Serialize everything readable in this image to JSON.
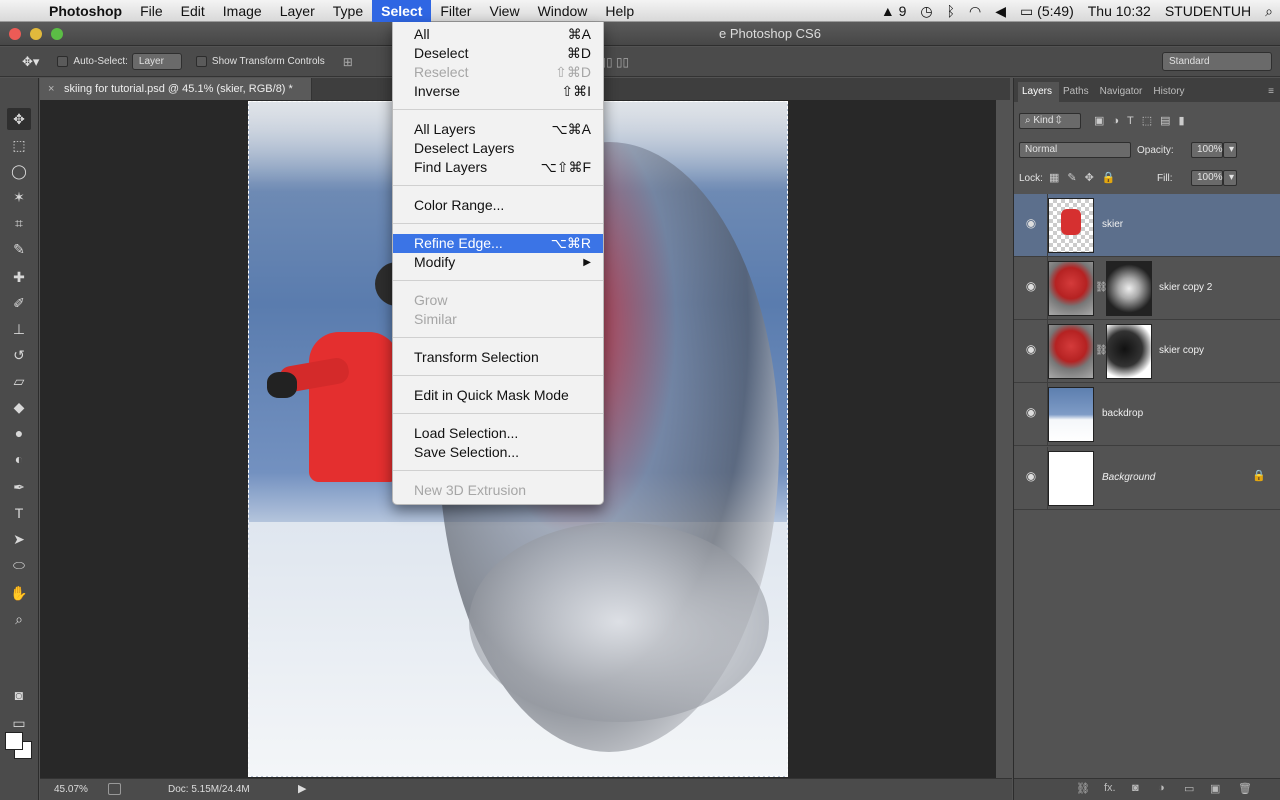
{
  "menubar": {
    "app": "Photoshop",
    "items": [
      "File",
      "Edit",
      "Image",
      "Layer",
      "Type",
      "Select",
      "Filter",
      "View",
      "Window",
      "Help"
    ],
    "active": "Select",
    "status": {
      "adobe_count": "9",
      "battery": "(5:49)",
      "clock": "Thu 10:32",
      "user": "STUDENTUH"
    }
  },
  "window": {
    "title": "e Photoshop CS6"
  },
  "options": {
    "auto_select_label": "Auto-Select:",
    "auto_select_value": "Layer",
    "show_transform_label": "Show Transform Controls",
    "workspace": "Standard"
  },
  "document": {
    "tab_title": "skiing for tutorial.psd @ 45.1% (skier, RGB/8) *"
  },
  "select_menu": {
    "items": [
      {
        "label": "All",
        "shortcut": "⌘A",
        "enabled": true
      },
      {
        "label": "Deselect",
        "shortcut": "⌘D",
        "enabled": true
      },
      {
        "label": "Reselect",
        "shortcut": "⇧⌘D",
        "enabled": false
      },
      {
        "label": "Inverse",
        "shortcut": "⇧⌘I",
        "enabled": true
      },
      {
        "label": "All Layers",
        "shortcut": "⌥⌘A",
        "enabled": true
      },
      {
        "label": "Deselect Layers",
        "shortcut": "",
        "enabled": true
      },
      {
        "label": "Find Layers",
        "shortcut": "⌥⇧⌘F",
        "enabled": true
      },
      {
        "label": "Color Range...",
        "shortcut": "",
        "enabled": true
      },
      {
        "label": "Refine Edge...",
        "shortcut": "⌥⌘R",
        "enabled": true,
        "highlighted": true
      },
      {
        "label": "Modify",
        "shortcut": "▶",
        "enabled": true
      },
      {
        "label": "Grow",
        "shortcut": "",
        "enabled": false
      },
      {
        "label": "Similar",
        "shortcut": "",
        "enabled": false
      },
      {
        "label": "Transform Selection",
        "shortcut": "",
        "enabled": true
      },
      {
        "label": "Edit in Quick Mask Mode",
        "shortcut": "",
        "enabled": true
      },
      {
        "label": "Load Selection...",
        "shortcut": "",
        "enabled": true
      },
      {
        "label": "Save Selection...",
        "shortcut": "",
        "enabled": true
      },
      {
        "label": "New 3D Extrusion",
        "shortcut": "",
        "enabled": false
      }
    ]
  },
  "status_bar": {
    "zoom": "45.07%",
    "doc_size": "Doc: 5.15M/24.4M"
  },
  "layers_panel": {
    "tabs": [
      "Layers",
      "Paths",
      "Navigator",
      "History"
    ],
    "kind_label": "Kind",
    "blend_mode": "Normal",
    "opacity_label": "Opacity:",
    "opacity": "100%",
    "lock_label": "Lock:",
    "fill_label": "Fill:",
    "fill": "100%",
    "layers": [
      {
        "name": "skier",
        "selected": true
      },
      {
        "name": "skier copy 2",
        "selected": false
      },
      {
        "name": "skier copy",
        "selected": false
      },
      {
        "name": "backdrop",
        "selected": false
      },
      {
        "name": "Background",
        "selected": false,
        "locked": true
      }
    ]
  },
  "colors": {
    "menu_highlight": "#3b74e6",
    "panel_bg": "#535353",
    "selected_layer": "#5c6f8c"
  }
}
